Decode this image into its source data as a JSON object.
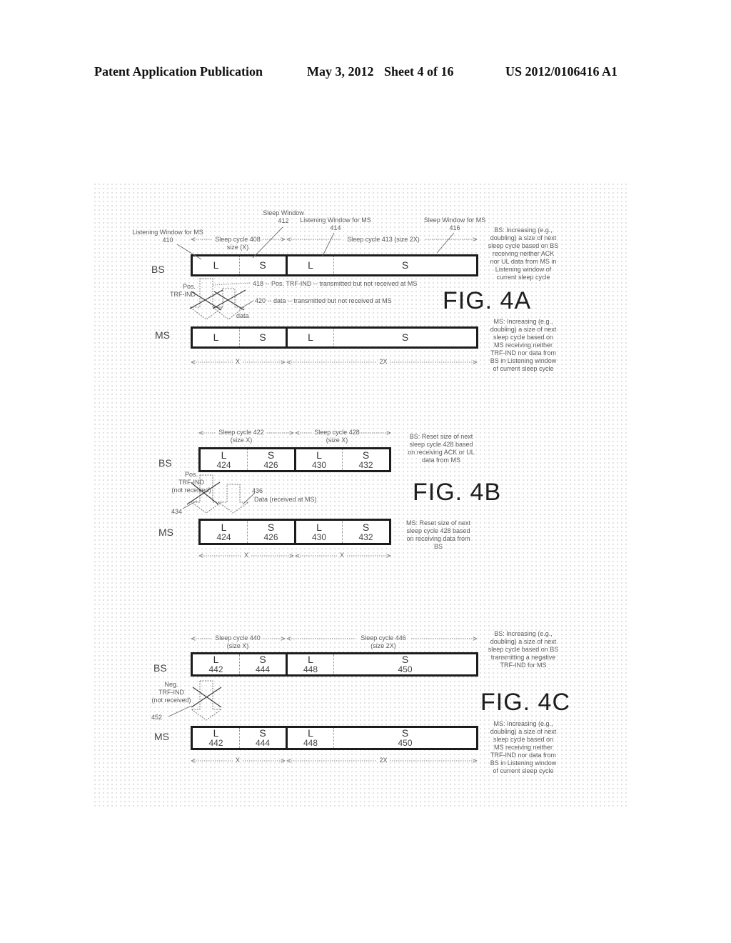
{
  "header": {
    "publication": "Patent Application Publication",
    "date": "May 3, 2012",
    "sheet": "Sheet 4 of 16",
    "number": "US 2012/0106416 A1"
  },
  "fig4a": {
    "title": "FIG. 4A",
    "bs_label": "BS",
    "ms_label": "MS",
    "bs_cells": [
      {
        "letter": "L"
      },
      {
        "letter": "S"
      },
      {
        "letter": "L"
      },
      {
        "letter": "S"
      }
    ],
    "ms_cells": [
      {
        "letter": "L"
      },
      {
        "letter": "S"
      },
      {
        "letter": "L"
      },
      {
        "letter": "S"
      }
    ],
    "annotations": {
      "listen_410": "Listening Window for MS\n410",
      "sleep_cycle_408": "Sleep cycle 408\nsize (X)",
      "sleep_window_412": "Sleep Window\n412",
      "listen_414": "Listening Window for MS\n414",
      "sleep_cycle_413": "Sleep cycle 413 (size 2X)",
      "sleep_window_416": "Sleep Window for MS\n416",
      "pos_trf_ind": "Pos.\nTRF-IND",
      "note_418": "418 -- Pos. TRF-IND -- transmitted but not received at MS",
      "note_420": "420 -- data -- transmitted but not received at MS",
      "data": "data"
    },
    "dims": [
      "X",
      "2X"
    ],
    "bs_note": "BS: Increasing (e.g.,\ndoubling) a size of next\nsleep cycle based on BS\nreceiving neither ACK\nnor UL data from MS in\nListening window of\ncurrent sleep cycle",
    "ms_note": "MS: Increasing (e.g.,\ndoubling) a size of next\nsleep cycle based on\nMS receiving neither\nTRF-IND nor data from\nBS in Listening window\nof current sleep cycle"
  },
  "fig4b": {
    "title": "FIG. 4B",
    "bs_label": "BS",
    "ms_label": "MS",
    "bs_cells": [
      {
        "letter": "L",
        "number": "424"
      },
      {
        "letter": "S",
        "number": "426"
      },
      {
        "letter": "L",
        "number": "430"
      },
      {
        "letter": "S",
        "number": "432"
      }
    ],
    "ms_cells": [
      {
        "letter": "L",
        "number": "424"
      },
      {
        "letter": "S",
        "number": "426"
      },
      {
        "letter": "L",
        "number": "430"
      },
      {
        "letter": "S",
        "number": "432"
      }
    ],
    "annotations": {
      "sleep_cycle_422": "Sleep cycle 422\n(size X)",
      "sleep_cycle_428": "Sleep cycle 428\n(size X)",
      "pos_trf_ind": "Pos.\nTRF-IND\n(not received)",
      "ref_434": "434",
      "ref_436": "436",
      "data_received": "Data (received at MS)"
    },
    "dims": [
      "X",
      "X"
    ],
    "bs_note": "BS: Reset size of next\nsleep cycle 428 based\non receiving ACK or UL\ndata from MS",
    "ms_note": "MS: Reset size of next\nsleep cycle 428 based\non receiving data from\nBS"
  },
  "fig4c": {
    "title": "FIG. 4C",
    "bs_label": "BS",
    "ms_label": "MS",
    "bs_cells": [
      {
        "letter": "L",
        "number": "442"
      },
      {
        "letter": "S",
        "number": "444"
      },
      {
        "letter": "L",
        "number": "448"
      },
      {
        "letter": "S",
        "number": "450"
      }
    ],
    "ms_cells": [
      {
        "letter": "L",
        "number": "442"
      },
      {
        "letter": "S",
        "number": "444"
      },
      {
        "letter": "L",
        "number": "448"
      },
      {
        "letter": "S",
        "number": "450"
      }
    ],
    "annotations": {
      "sleep_cycle_440": "Sleep cycle 440\n(size X)",
      "sleep_cycle_446": "Sleep cycle 446\n(size 2X)",
      "neg_trf_ind": "Neg.\nTRF-IND\n(not received)",
      "ref_452": "452"
    },
    "dims": [
      "X",
      "2X"
    ],
    "bs_note": "BS: Increasing (e.g.,\ndoubling) a size of next\nsleep cycle based on BS\ntransmitting a negative\nTRF-IND for MS",
    "ms_note": "MS: Increasing (e.g.,\ndoubling) a size of next\nsleep cycle based on\nMS receiving neither\nTRF-IND nor data from\nBS in Listening window\nof current sleep cycle"
  }
}
